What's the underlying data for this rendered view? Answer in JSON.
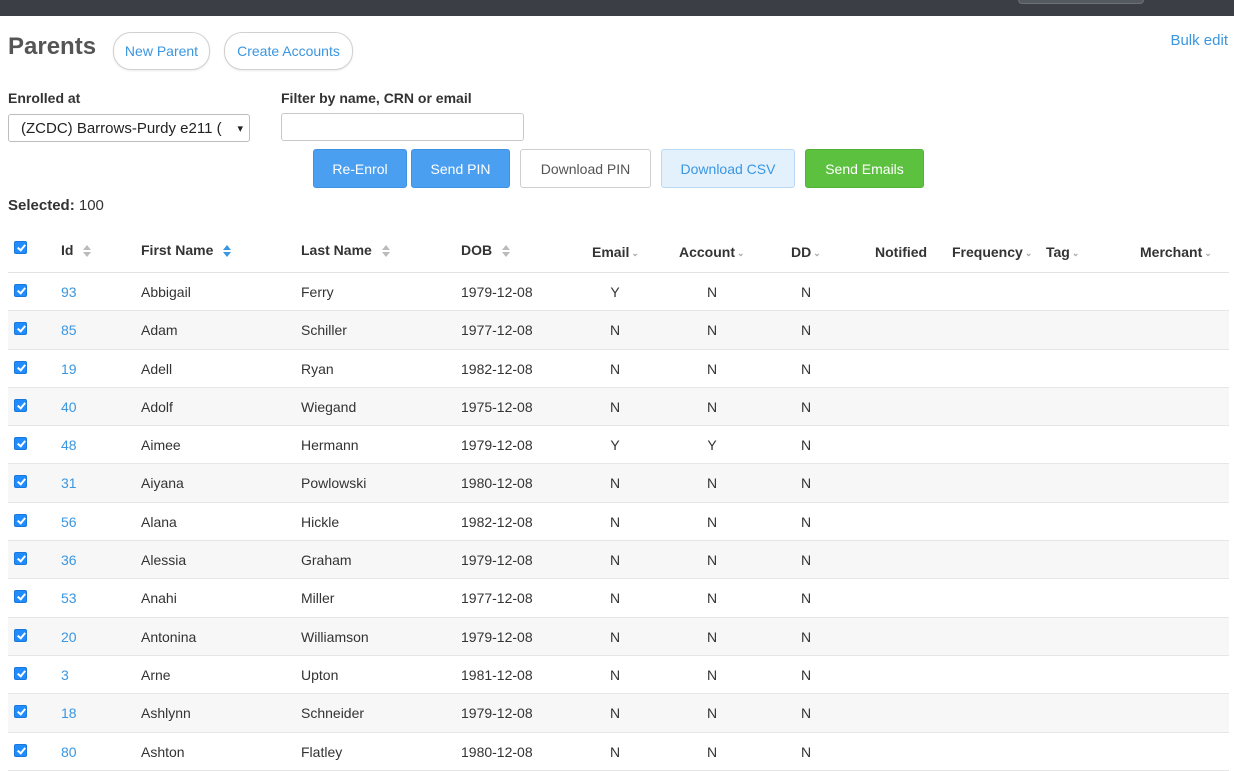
{
  "header": {
    "title": "Parents",
    "new_parent": "New Parent",
    "create_accounts": "Create Accounts",
    "bulk_edit": "Bulk edit"
  },
  "filters": {
    "enrolled_label": "Enrolled at",
    "enrolled_value": "(ZCDC) Barrows-Purdy e211 (",
    "filter_label": "Filter by name, CRN or email",
    "filter_value": "",
    "filter_placeholder": ""
  },
  "actions": {
    "re_enrol": "Re-Enrol",
    "send_pin": "Send PIN",
    "download_pin": "Download PIN",
    "download_csv": "Download CSV",
    "send_emails": "Send Emails"
  },
  "selection": {
    "label": "Selected:",
    "count": "100"
  },
  "table": {
    "columns": {
      "id": "Id",
      "first_name": "First Name",
      "last_name": "Last Name",
      "dob": "DOB",
      "email": "Email",
      "account": "Account",
      "dd": "DD",
      "notified": "Notified",
      "frequency": "Frequency",
      "tag": "Tag",
      "merchant": "Merchant"
    },
    "rows": [
      {
        "id": "93",
        "first": "Abbigail",
        "last": "Ferry",
        "dob": "1979-12-08",
        "email": "Y",
        "account": "N",
        "dd": "N"
      },
      {
        "id": "85",
        "first": "Adam",
        "last": "Schiller",
        "dob": "1977-12-08",
        "email": "N",
        "account": "N",
        "dd": "N"
      },
      {
        "id": "19",
        "first": "Adell",
        "last": "Ryan",
        "dob": "1982-12-08",
        "email": "N",
        "account": "N",
        "dd": "N"
      },
      {
        "id": "40",
        "first": "Adolf",
        "last": "Wiegand",
        "dob": "1975-12-08",
        "email": "N",
        "account": "N",
        "dd": "N"
      },
      {
        "id": "48",
        "first": "Aimee",
        "last": "Hermann",
        "dob": "1979-12-08",
        "email": "Y",
        "account": "Y",
        "dd": "N"
      },
      {
        "id": "31",
        "first": "Aiyana",
        "last": "Powlowski",
        "dob": "1980-12-08",
        "email": "N",
        "account": "N",
        "dd": "N"
      },
      {
        "id": "56",
        "first": "Alana",
        "last": "Hickle",
        "dob": "1982-12-08",
        "email": "N",
        "account": "N",
        "dd": "N"
      },
      {
        "id": "36",
        "first": "Alessia",
        "last": "Graham",
        "dob": "1979-12-08",
        "email": "N",
        "account": "N",
        "dd": "N"
      },
      {
        "id": "53",
        "first": "Anahi",
        "last": "Miller",
        "dob": "1977-12-08",
        "email": "N",
        "account": "N",
        "dd": "N"
      },
      {
        "id": "20",
        "first": "Antonina",
        "last": "Williamson",
        "dob": "1979-12-08",
        "email": "N",
        "account": "N",
        "dd": "N"
      },
      {
        "id": "3",
        "first": "Arne",
        "last": "Upton",
        "dob": "1981-12-08",
        "email": "N",
        "account": "N",
        "dd": "N"
      },
      {
        "id": "18",
        "first": "Ashlynn",
        "last": "Schneider",
        "dob": "1979-12-08",
        "email": "N",
        "account": "N",
        "dd": "N"
      },
      {
        "id": "80",
        "first": "Ashton",
        "last": "Flatley",
        "dob": "1980-12-08",
        "email": "N",
        "account": "N",
        "dd": "N"
      }
    ]
  },
  "colors": {
    "primary": "#4a9ff0",
    "link": "#3a96e0",
    "success": "#5cc13f",
    "checkbox": "#1f8cff",
    "topbar": "#3b3f45"
  }
}
